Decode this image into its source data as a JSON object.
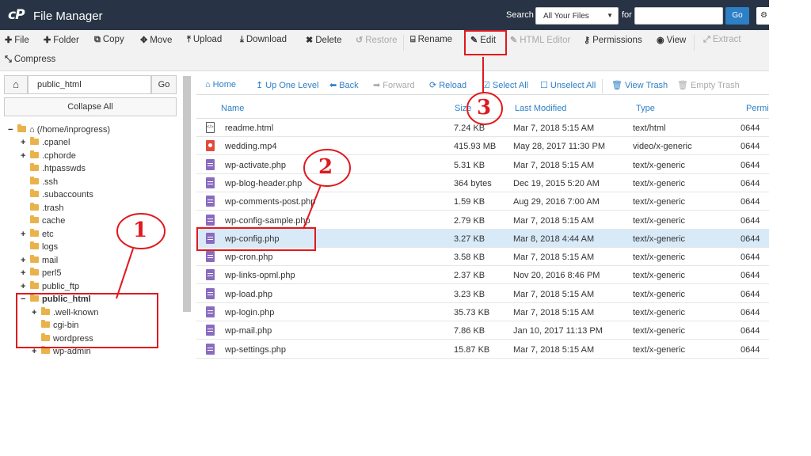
{
  "header": {
    "logo": "cP",
    "title": "File Manager",
    "search_label": "Search",
    "search_scope": "All Your Files",
    "for_label": "for",
    "search_value": "",
    "go_label": "Go",
    "settings_label": "Settings"
  },
  "toolbar": {
    "file": "File",
    "folder": "Folder",
    "copy": "Copy",
    "move": "Move",
    "upload": "Upload",
    "download": "Download",
    "delete": "Delete",
    "restore": "Restore",
    "rename": "Rename",
    "edit": "Edit",
    "html_editor": "HTML Editor",
    "permissions": "Permissions",
    "view": "View",
    "extract": "Extract",
    "compress": "Compress"
  },
  "sidebar": {
    "path_value": "public_html",
    "go_label": "Go",
    "collapse_label": "Collapse All",
    "tree": [
      {
        "label": "(/home/inprogress)",
        "pm": "−",
        "home": true
      },
      {
        "label": ".cpanel",
        "pm": "+"
      },
      {
        "label": ".cphorde",
        "pm": "+"
      },
      {
        "label": ".htpasswds",
        "pm": ""
      },
      {
        "label": ".ssh",
        "pm": ""
      },
      {
        "label": ".subaccounts",
        "pm": ""
      },
      {
        "label": ".trash",
        "pm": ""
      },
      {
        "label": "cache",
        "pm": ""
      },
      {
        "label": "etc",
        "pm": "+"
      },
      {
        "label": "logs",
        "pm": ""
      },
      {
        "label": "mail",
        "pm": "+"
      },
      {
        "label": "perl5",
        "pm": "+"
      },
      {
        "label": "public_ftp",
        "pm": "+"
      },
      {
        "label": "public_html",
        "pm": "−",
        "bold": true
      },
      {
        "label": ".well-known",
        "pm": "+"
      },
      {
        "label": "cgi-bin",
        "pm": ""
      },
      {
        "label": "wordpress",
        "pm": ""
      },
      {
        "label": "wp-admin",
        "pm": "+"
      }
    ]
  },
  "nav": {
    "home": "Home",
    "up": "Up One Level",
    "back": "Back",
    "forward": "Forward",
    "reload": "Reload",
    "select_all": "Select All",
    "unselect_all": "Unselect All",
    "view_trash": "View Trash",
    "empty_trash": "Empty Trash"
  },
  "table": {
    "headers": {
      "name": "Name",
      "size": "Size",
      "modified": "Last Modified",
      "type": "Type",
      "perms": "Permi"
    },
    "rows": [
      {
        "name": "readme.html",
        "size": "7.24 KB",
        "modified": "Mar 7, 2018 5:15 AM",
        "type": "text/html",
        "perms": "0644",
        "icon": "html"
      },
      {
        "name": "wedding.mp4",
        "size": "415.93 MB",
        "modified": "May 28, 2017 11:30 PM",
        "type": "video/x-generic",
        "perms": "0644",
        "icon": "video"
      },
      {
        "name": "wp-activate.php",
        "size": "5.31 KB",
        "modified": "Mar 7, 2018 5:15 AM",
        "type": "text/x-generic",
        "perms": "0644",
        "icon": "php"
      },
      {
        "name": "wp-blog-header.php",
        "size": "364 bytes",
        "modified": "Dec 19, 2015 5:20 AM",
        "type": "text/x-generic",
        "perms": "0644",
        "icon": "php"
      },
      {
        "name": "wp-comments-post.php",
        "size": "1.59 KB",
        "modified": "Aug 29, 2016 7:00 AM",
        "type": "text/x-generic",
        "perms": "0644",
        "icon": "php"
      },
      {
        "name": "wp-config-sample.php",
        "size": "2.79 KB",
        "modified": "Mar 7, 2018 5:15 AM",
        "type": "text/x-generic",
        "perms": "0644",
        "icon": "php"
      },
      {
        "name": "wp-config.php",
        "size": "3.27 KB",
        "modified": "Mar 8, 2018 4:44 AM",
        "type": "text/x-generic",
        "perms": "0644",
        "icon": "php",
        "selected": true
      },
      {
        "name": "wp-cron.php",
        "size": "3.58 KB",
        "modified": "Mar 7, 2018 5:15 AM",
        "type": "text/x-generic",
        "perms": "0644",
        "icon": "php"
      },
      {
        "name": "wp-links-opml.php",
        "size": "2.37 KB",
        "modified": "Nov 20, 2016 8:46 PM",
        "type": "text/x-generic",
        "perms": "0644",
        "icon": "php"
      },
      {
        "name": "wp-load.php",
        "size": "3.23 KB",
        "modified": "Mar 7, 2018 5:15 AM",
        "type": "text/x-generic",
        "perms": "0644",
        "icon": "php"
      },
      {
        "name": "wp-login.php",
        "size": "35.73 KB",
        "modified": "Mar 7, 2018 5:15 AM",
        "type": "text/x-generic",
        "perms": "0644",
        "icon": "php"
      },
      {
        "name": "wp-mail.php",
        "size": "7.86 KB",
        "modified": "Jan 10, 2017 11:13 PM",
        "type": "text/x-generic",
        "perms": "0644",
        "icon": "php"
      },
      {
        "name": "wp-settings.php",
        "size": "15.87 KB",
        "modified": "Mar 7, 2018 5:15 AM",
        "type": "text/x-generic",
        "perms": "0644",
        "icon": "php"
      }
    ]
  },
  "annotations": {
    "one": "1",
    "two": "2",
    "three": "3",
    "color": "#e0191f"
  }
}
